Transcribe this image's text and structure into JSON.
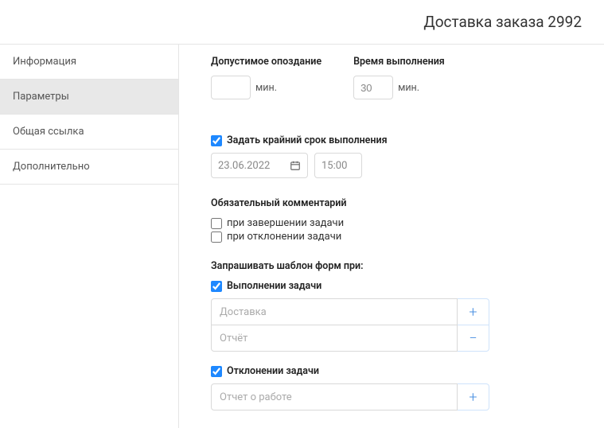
{
  "header": {
    "title": "Доставка заказа 2992"
  },
  "sidebar": {
    "items": [
      {
        "label": "Информация"
      },
      {
        "label": "Параметры"
      },
      {
        "label": "Общая ссылка"
      },
      {
        "label": "Дополнительно"
      }
    ]
  },
  "params": {
    "allowed_delay_label": "Допустимое опоздание",
    "exec_time_label": "Время выполнения",
    "allowed_delay_value": "",
    "exec_time_value": "30",
    "minutes_suffix": "мин.",
    "deadline_check_label": "Задать крайний срок выполнения",
    "deadline_date": "23.06.2022",
    "deadline_time": "15:00",
    "mandatory_comment_title": "Обязательный комментарий",
    "on_complete_label": "при завершении задачи",
    "on_reject_label": "при отклонении задачи",
    "templates_title": "Запрашивать шаблон форм при:",
    "on_task_complete_label": "Выполнении задачи",
    "complete_templates": [
      {
        "name": "Доставка",
        "action": "add"
      },
      {
        "name": "Отчёт",
        "action": "remove"
      }
    ],
    "on_task_reject_label": "Отклонении задачи",
    "reject_templates": [
      {
        "name": "Отчет о работе",
        "action": "add"
      }
    ]
  }
}
